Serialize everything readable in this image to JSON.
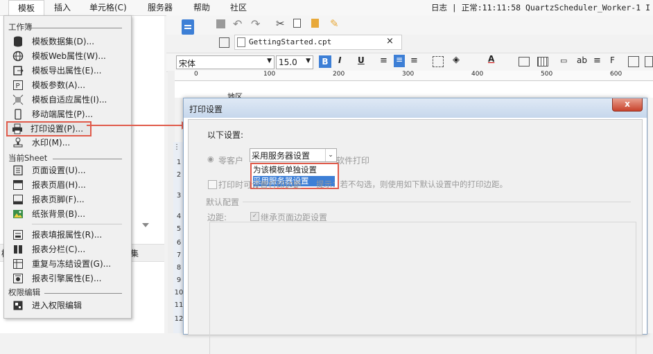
{
  "menubar": {
    "items": [
      "模板",
      "插入",
      "单元格(C)",
      "服务器",
      "帮助",
      "社区"
    ],
    "status": "日志 | 正常:11:11:58 QuartzScheduler_Worker-1 I"
  },
  "template_menu": {
    "section_workbook": "工作簿",
    "workbook_items": [
      {
        "icon": "database-icon",
        "label": "模板数据集(D)..."
      },
      {
        "icon": "globe-icon",
        "label": "模板Web属性(W)..."
      },
      {
        "icon": "export-icon",
        "label": "模板导出属性(E)..."
      },
      {
        "icon": "parameter-icon",
        "label": "模板参数(A)..."
      },
      {
        "icon": "adapt-icon",
        "label": "模板自适应属性(I)..."
      },
      {
        "icon": "mobile-icon",
        "label": "移动端属性(P)..."
      },
      {
        "icon": "printer-icon",
        "label": "打印设置(P)..."
      },
      {
        "icon": "stamp-icon",
        "label": "水印(M)..."
      }
    ],
    "section_sheet": "当前Sheet",
    "sheet_items": [
      {
        "icon": "page-setup-icon",
        "label": "页面设置(U)..."
      },
      {
        "icon": "header-icon",
        "label": "报表页眉(H)..."
      },
      {
        "icon": "footer-icon",
        "label": "报表页脚(F)..."
      },
      {
        "icon": "image-icon",
        "label": "纸张背景(B)..."
      }
    ],
    "sheet_items2": [
      {
        "icon": "form-fill-icon",
        "label": "报表填报属性(R)..."
      },
      {
        "icon": "columns-icon",
        "label": "报表分栏(C)..."
      },
      {
        "icon": "freeze-icon",
        "label": "重复与冻结设置(G)..."
      },
      {
        "icon": "engine-icon",
        "label": "报表引擎属性(E)..."
      }
    ],
    "section_permission": "权限编辑",
    "permission_items": [
      {
        "icon": "permission-icon",
        "label": "进入权限编辑"
      }
    ]
  },
  "left_panel": {
    "partial_label": "集",
    "partial_label2": "模"
  },
  "editor": {
    "tab_title": "GettingStarted.cpt",
    "font_name": "宋体",
    "font_size": "15.0",
    "ruler_ticks": [
      "0",
      "100",
      "200",
      "300",
      "400",
      "500",
      "600"
    ],
    "row_numbers": [
      "1",
      "2",
      "3",
      "4",
      "5",
      "6",
      "7",
      "8",
      "9",
      "10",
      "11",
      "12"
    ],
    "cell_text": "地区"
  },
  "print_dialog": {
    "title": "打印设置",
    "setting_label": "以下设置:",
    "selected_value": "采用服务器设置",
    "options": [
      "为该模板单独设置",
      "采用服务器设置"
    ],
    "radio_label_left": "零客户",
    "radio_label_right": "软件打印",
    "checkbox_label": "打印时可设置打印边距",
    "hint": "提示：若不勾选，则使用如下默认设置中的打印边距。",
    "group_title": "默认配置",
    "margin_label": "边距:",
    "inherit_label": "继承页面边距设置",
    "close_symbol": "x"
  },
  "colors": {
    "highlight_border": "#e05a4a",
    "selected_option": "#3d7fd6",
    "title_bar": "#c6d7ec"
  }
}
